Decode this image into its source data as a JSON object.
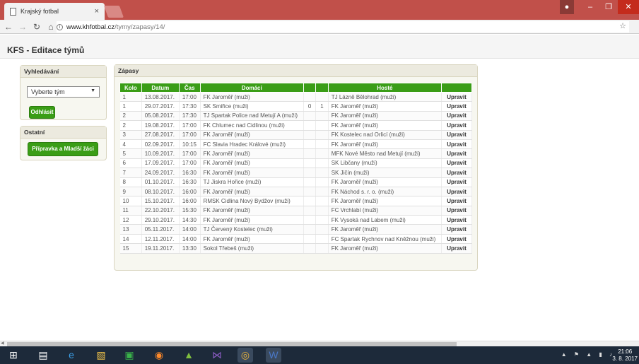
{
  "browser": {
    "tab_title": "Krajský fotbal",
    "tab_close": "×",
    "url_host": "www.khfotbal.cz",
    "url_path": "/tymy/zapasy/14/"
  },
  "page": {
    "title": "KFS - Editace týmů"
  },
  "sidebar": {
    "search_heading": "Vyhledávání",
    "team_select_value": "Vyberte tým",
    "logout_label": "Odhlásit",
    "other_heading": "Ostatní",
    "youth_label": "Přípravka a Mladší žáci"
  },
  "matches": {
    "heading": "Zápasy",
    "columns": [
      "Kolo",
      "Datum",
      "Čas",
      "Domácí",
      "",
      "",
      "Hosté",
      ""
    ],
    "action_label": "Upravit",
    "rows": [
      {
        "round": "1",
        "date": "13.08.2017.",
        "time": "17:00",
        "home": "FK Jaroměř (muži)",
        "s1": "",
        "s2": "",
        "away": "TJ Lázně Bělohrad (muži)"
      },
      {
        "round": "1",
        "date": "29.07.2017.",
        "time": "17:30",
        "home": "SK Smiřice (muži)",
        "s1": "0",
        "s2": "1",
        "away": "FK Jaroměř (muži)"
      },
      {
        "round": "2",
        "date": "05.08.2017.",
        "time": "17:30",
        "home": "TJ Spartak Police nad Metují A (muži)",
        "s1": "",
        "s2": "",
        "away": "FK Jaroměř (muži)"
      },
      {
        "round": "2",
        "date": "19.08.2017.",
        "time": "17:00",
        "home": "FK Chlumec nad Cidlinou (muži)",
        "s1": "",
        "s2": "",
        "away": "FK Jaroměř (muži)"
      },
      {
        "round": "3",
        "date": "27.08.2017.",
        "time": "17:00",
        "home": "FK Jaroměř (muži)",
        "s1": "",
        "s2": "",
        "away": "FK Kostelec nad Orlicí (muži)"
      },
      {
        "round": "4",
        "date": "02.09.2017.",
        "time": "10:15",
        "home": "FC Slavia Hradec Králové (muži)",
        "s1": "",
        "s2": "",
        "away": "FK Jaroměř (muži)"
      },
      {
        "round": "5",
        "date": "10.09.2017.",
        "time": "17:00",
        "home": "FK Jaroměř (muži)",
        "s1": "",
        "s2": "",
        "away": "MFK Nové Město nad Metují (muži)"
      },
      {
        "round": "6",
        "date": "17.09.2017.",
        "time": "17:00",
        "home": "FK Jaroměř (muži)",
        "s1": "",
        "s2": "",
        "away": "SK Libčany (muži)"
      },
      {
        "round": "7",
        "date": "24.09.2017.",
        "time": "16:30",
        "home": "FK Jaroměř (muži)",
        "s1": "",
        "s2": "",
        "away": "SK Jičín (muži)"
      },
      {
        "round": "8",
        "date": "01.10.2017.",
        "time": "16:30",
        "home": "TJ Jiskra Hořice (muži)",
        "s1": "",
        "s2": "",
        "away": "FK Jaroměř (muži)"
      },
      {
        "round": "9",
        "date": "08.10.2017.",
        "time": "16:00",
        "home": "FK Jaroměř (muži)",
        "s1": "",
        "s2": "",
        "away": "FK Náchod s. r. o. (muži)"
      },
      {
        "round": "10",
        "date": "15.10.2017.",
        "time": "16:00",
        "home": "RMSK Cidlina Nový Bydžov (muži)",
        "s1": "",
        "s2": "",
        "away": "FK Jaroměř (muži)"
      },
      {
        "round": "11",
        "date": "22.10.2017.",
        "time": "15:30",
        "home": "FK Jaroměř (muži)",
        "s1": "",
        "s2": "",
        "away": "FC Vrchlabí (muži)"
      },
      {
        "round": "12",
        "date": "29.10.2017.",
        "time": "14:30",
        "home": "FK Jaroměř (muži)",
        "s1": "",
        "s2": "",
        "away": "FK Vysoká nad Labem (muži)"
      },
      {
        "round": "13",
        "date": "05.11.2017.",
        "time": "14:00",
        "home": "TJ Červený Kostelec (muži)",
        "s1": "",
        "s2": "",
        "away": "FK Jaroměř (muži)"
      },
      {
        "round": "14",
        "date": "12.11.2017.",
        "time": "14:00",
        "home": "FK Jaroměř (muži)",
        "s1": "",
        "s2": "",
        "away": "FC Spartak Rychnov nad Kněžnou (muži)"
      },
      {
        "round": "15",
        "date": "19.11.2017.",
        "time": "13:30",
        "home": "Sokol Třebeš (muži)",
        "s1": "",
        "s2": "",
        "away": "FK Jaroměř (muži)"
      }
    ]
  },
  "taskbar": {
    "time": "21:06",
    "date": "3. 8. 2017"
  },
  "icons": [
    "page-icon",
    "back-icon",
    "forward-icon",
    "reload-icon",
    "home-icon",
    "info-icon",
    "star-icon"
  ],
  "colors": {
    "accent_green": "#3a9d16",
    "titlebar": "#c1504a"
  }
}
